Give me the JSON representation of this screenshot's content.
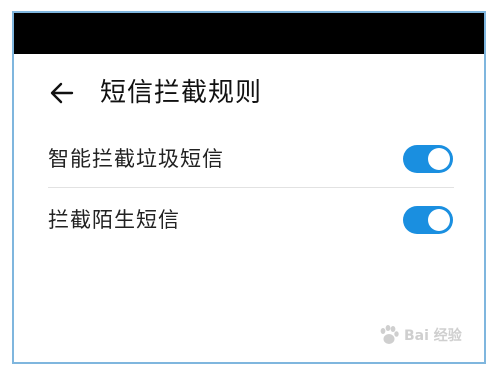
{
  "header": {
    "back_icon": "arrow-left-icon",
    "title": "短信拦截规则"
  },
  "settings": [
    {
      "label": "智能拦截垃圾短信",
      "enabled": true
    },
    {
      "label": "拦截陌生短信",
      "enabled": true
    }
  ],
  "colors": {
    "toggle_on": "#1a8fe0",
    "status_bar": "#000000",
    "frame_border": "#7fb6de"
  },
  "watermark": {
    "icon": "baidu-paw-icon",
    "text": "Bai 经验"
  }
}
